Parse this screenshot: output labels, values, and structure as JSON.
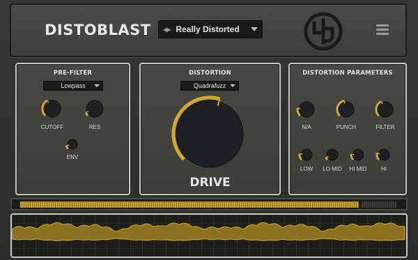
{
  "header": {
    "brand": "DISTOBLAST",
    "preset_arrows": "◀▶",
    "preset_name": "Really Distorted"
  },
  "icons": {
    "logo": "logo-emblem-icon",
    "menu": "hamburger-menu-icon",
    "dropdown": "chevron-down-icon"
  },
  "colors": {
    "accent": "#d4a92a",
    "knob_body": "#1f2023",
    "panel_border": "#c9c9c1",
    "background": "#2c2d29"
  },
  "prefilter": {
    "title": "PRE-FILTER",
    "mode": "Lowpass",
    "knobs": [
      {
        "label": "CUTOFF",
        "value": 0.38
      },
      {
        "label": "RES",
        "value": 0.08
      },
      {
        "label": "ENV",
        "value": 0.12
      }
    ]
  },
  "distortion": {
    "title": "DISTORTION",
    "type": "Quadrafuzz",
    "drive_label": "DRIVE",
    "drive_value": 0.56
  },
  "params": {
    "title": "DISTORTION PARAMETERS",
    "knobs": [
      {
        "label": "N/A",
        "value": 0.2
      },
      {
        "label": "PUNCH",
        "value": 0.45
      },
      {
        "label": "FILTER",
        "value": 0.4
      },
      {
        "label": "LOW",
        "value": 0.2
      },
      {
        "label": "LO MID",
        "value": 0.08
      },
      {
        "label": "HI MID",
        "value": 0.18
      },
      {
        "label": "HI",
        "value": 0.22
      }
    ]
  },
  "meter": {
    "level": 0.9
  }
}
